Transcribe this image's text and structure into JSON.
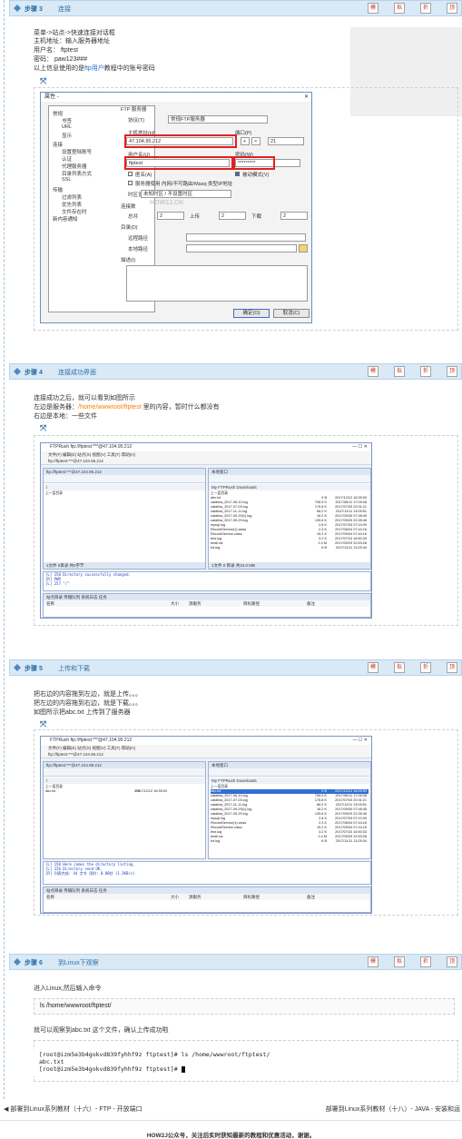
{
  "steps": [
    {
      "label": "步骤 3",
      "title": "连接"
    },
    {
      "label": "步骤 4",
      "title": "连接成功界面"
    },
    {
      "label": "步骤 5",
      "title": "上传和下载"
    },
    {
      "label": "步骤 6",
      "title": "到Linux下观察"
    }
  ],
  "tools": [
    "模",
    "拟",
    "折",
    "顶"
  ],
  "step3": {
    "line1": "菜单->站点->快速连接对话框",
    "line2": "主机地址：输入服务器地址",
    "line3": "用户名：  ftptest",
    "line4": "密码：  paw123###",
    "line5_a": "以上信息使用的是",
    "line5_link": "ftp用户",
    "line5_b": "教程中的账号密码"
  },
  "dialog": {
    "title": "属性 -",
    "close": "✕",
    "tree": [
      "常规",
      "书签",
      "URL",
      "显示",
      "连接",
      "设置登陆账号",
      "认证",
      "代理服务器",
      "目录列表方式",
      "SSL",
      "传输",
      "过滤列表",
      "优先列表",
      "文件存在时",
      "新内容通知"
    ],
    "ftp_server": "FTP 服务器",
    "protocol_label": "协议(T)",
    "protocol_value": "常规FTP服务器",
    "host_label": "主机地址(H)",
    "host_value": "47.104.95.212",
    "port_label": "端口(P)",
    "port_value": "21",
    "user_label": "用户名(U)",
    "user_value": "ftptest",
    "pass_label": "密码(W)",
    "pass_value": "*********",
    "anon_label": "匿名(A)",
    "passive_label": "被动模式(V)",
    "intranet_label": "服务器使用 内网/不可路由/Masq 类型IP地址",
    "tz_label": "时区设置",
    "tz_value": "未知时区 / 不设置时区",
    "conn_label": "连接数",
    "total_label": "总共",
    "total_value": "2",
    "upload_label": "上传",
    "upload_value": "2",
    "download_label": "下载",
    "download_value": "2",
    "dir_label": "目录(D)",
    "remote_label": "远程路径",
    "local_label": "本地路径",
    "desc_label": "描述(I)",
    "ok": "确定(O)",
    "cancel": "取消(C)"
  },
  "step4": {
    "line1": "连接成功之后，就可以看到如图所示",
    "line2_a": "左边是服务器：",
    "line2_path": "/home/wwwroot/ftptest",
    "line2_b": " 里的内容，暂时什么都没有",
    "line3": "右边是本地：一些文件"
  },
  "ftp1": {
    "title": "FTPRush   ftp://ftptest:***@47.104.95.212",
    "menu": "文件(F)  编辑(E)  站点(S)  视图(V)  工具(T)  帮助(H)",
    "toolbar": "ftp://ftptest:***@47.104.95.212",
    "left_tab": "ftp://ftptest:***@47.104.95.212",
    "right_tab": "本地窗口",
    "left_head": "/",
    "right_head": "My FTPRush Downloads",
    "left_files": [
      "上一层目录"
    ],
    "right_files": [
      {
        "n": "上一层目录",
        "s": "",
        "d": ""
      },
      {
        "n": "abc.txt",
        "s": "9 B",
        "d": "2017/12/12 16:39:53"
      },
      {
        "n": "catalina_2017-06-10.log",
        "s": "706.9 K",
        "d": "2017/06/11 17:05:08"
      },
      {
        "n": "catalina_2017-07-03.log",
        "s": "176.8 K",
        "d": "2017/07/03 20:31:21"
      },
      {
        "n": "catalina_2017-11-11.log",
        "s": "66.2 K",
        "d": "2017/11/11 13:09:51"
      },
      {
        "n": "catalina_2017-09-29(1).log",
        "s": "16.2 K",
        "d": "2017/09/30 07:48:45"
      },
      {
        "n": "catalina_2017-09-29.log",
        "s": "139.6 K",
        "d": "2017/09/29 22:35:46"
      },
      {
        "n": "mysql.log",
        "s": "2.8 K",
        "d": "2017/07/03 07:10:09"
      },
      {
        "n": "RecordService(1).class",
        "s": "2.3 K",
        "d": "2017/06/04 07:44:16"
      },
      {
        "n": "RecordService.class",
        "s": "15.2 K",
        "d": "2017/09/04 07:44:16"
      },
      {
        "n": "test.log",
        "s": "3.2 K",
        "d": "2017/07/24 16:50:33"
      },
      {
        "n": "tmall.rar",
        "s": "2.4 M",
        "d": "2017/09/29 22:53:28"
      },
      {
        "n": "txt.log",
        "s": "6 B",
        "d": "2017/11/11 13:25:34"
      }
    ],
    "left_status": "1文件 0目录 共0字节",
    "right_status": "1文件 0 目录 共24.0 MB",
    "log": [
      "[L] 250 Directory successfully changed.",
      "[R] PWD",
      "[L] 257 \"/\""
    ],
    "queue_tabs": "站点目录   传输队列   系统日志   任务",
    "queue_cols": [
      "名称",
      "大小",
      "源服务",
      "目标路径",
      "备注"
    ]
  },
  "step5": {
    "line1": "把右边的内容拖到左边，就是上传。。。",
    "line2": "把左边的内容拖到右边，就是下载。。。",
    "line3": "如图所示把abc.txt 上传到了服务器"
  },
  "ftp2": {
    "title": "FTPRush   ftp://ftptest:***@47.104.95.212",
    "left_files": [
      {
        "n": "上一层目录",
        "s": "",
        "d": ""
      },
      {
        "n": "abc.txt",
        "s": "9 B",
        "d": "2017/12/12 16:39:00"
      }
    ],
    "log": [
      "[L] 150 Here comes the directory listing.",
      "[L] 226 Directory send OK.",
      "[R] 列表完成: 44 字节 用时: 0.00秒 (1.3KB/s)"
    ]
  },
  "step6": {
    "line1": "进入Linux,然后输入命令",
    "cmd": "ls /home/wwwroot/ftptest/",
    "line2": "就可以观察到abc.txt 这个文件，确认上传成功啦",
    "term1": "[root@izm5e3b4gokvd839fyhhf9z ftptest]# ls /home/wwwroot/ftptest/",
    "term2": "abc.txt",
    "term3": "[root@izm5e3b4gokvd839fyhhf9z ftptest]# "
  },
  "nav": {
    "prev": "◀ 部署到Linux系列教材（十六）- FTP - 开放端口",
    "next": "部署到Linux系列教材（十八）- JAVA - 安装和运"
  },
  "footer": "HOW2J公众号，关注后实时获知最新的教程和优惠活动，谢谢。",
  "watermark": "HOW2J.CN",
  "expand_icon": "expand-arrows-icon"
}
